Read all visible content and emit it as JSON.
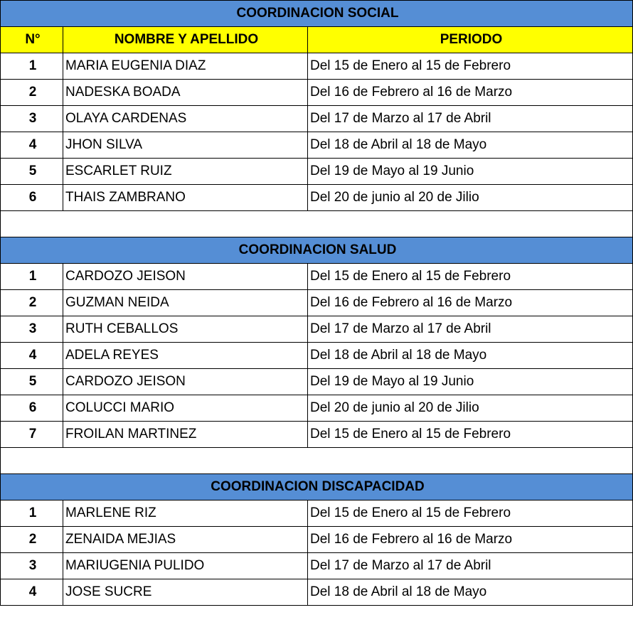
{
  "headers": {
    "number": "N°",
    "name": "NOMBRE Y APELLIDO",
    "period": "PERIODO"
  },
  "sections": [
    {
      "title": "COORDINACION SOCIAL",
      "rows": [
        {
          "n": "1",
          "name": "MARIA EUGENIA DIAZ",
          "period": "Del 15 de Enero al 15 de Febrero"
        },
        {
          "n": "2",
          "name": "NADESKA BOADA",
          "period": "Del 16 de Febrero al 16 de Marzo"
        },
        {
          "n": "3",
          "name": "OLAYA CARDENAS",
          "period": "Del 17 de Marzo al 17 de Abril"
        },
        {
          "n": "4",
          "name": "JHON SILVA",
          "period": "Del 18 de Abril al 18 de Mayo"
        },
        {
          "n": "5",
          "name": "ESCARLET RUIZ",
          "period": "Del 19 de Mayo al 19 Junio"
        },
        {
          "n": "6",
          "name": "THAIS ZAMBRANO",
          "period": "Del 20 de junio al 20 de Jilio"
        }
      ]
    },
    {
      "title": "COORDINACION SALUD",
      "rows": [
        {
          "n": "1",
          "name": "CARDOZO JEISON",
          "period": "Del 15 de Enero al 15 de Febrero"
        },
        {
          "n": "2",
          "name": "GUZMAN NEIDA",
          "period": "Del 16 de Febrero al 16 de Marzo"
        },
        {
          "n": "3",
          "name": "RUTH CEBALLOS",
          "period": "Del 17 de Marzo al 17 de Abril"
        },
        {
          "n": "4",
          "name": "ADELA REYES",
          "period": "Del 18 de Abril al 18 de Mayo"
        },
        {
          "n": "5",
          "name": "CARDOZO JEISON",
          "period": "Del 19 de Mayo al 19 Junio"
        },
        {
          "n": "6",
          "name": "COLUCCI MARIO",
          "period": "Del 20 de junio al 20 de Jilio"
        },
        {
          "n": "7",
          "name": "FROILAN MARTINEZ",
          "period": "Del 15 de Enero al 15 de Febrero"
        }
      ]
    },
    {
      "title": "COORDINACION DISCAPACIDAD",
      "rows": [
        {
          "n": "1",
          "name": "MARLENE RIZ",
          "period": "Del 15 de Enero al 15 de Febrero"
        },
        {
          "n": "2",
          "name": "ZENAIDA MEJIAS",
          "period": "Del 16 de Febrero al 16 de Marzo"
        },
        {
          "n": "3",
          "name": "MARIUGENIA PULIDO",
          "period": "Del 17 de Marzo al 17 de Abril"
        },
        {
          "n": "4",
          "name": "JOSE SUCRE",
          "period": "Del 18 de Abril al 18 de Mayo"
        }
      ]
    }
  ]
}
